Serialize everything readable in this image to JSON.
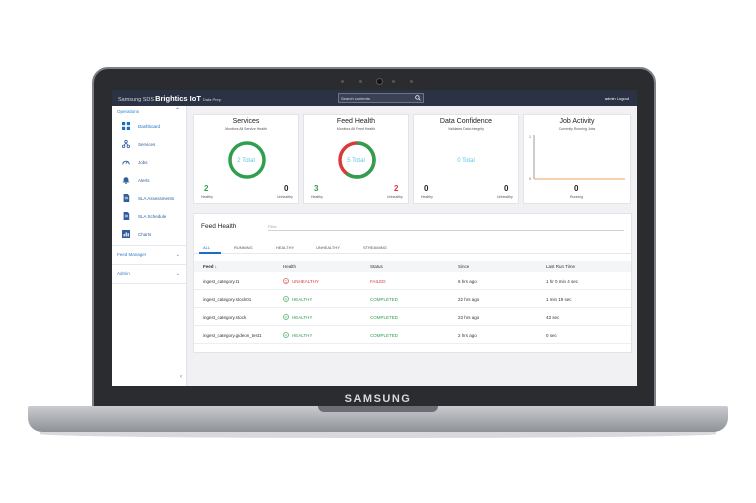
{
  "device": {
    "brand": "SAMSUNG"
  },
  "topbar": {
    "logo_prefix": "Samsung SDS",
    "logo_name": "Brightics IoT",
    "logo_suffix": "Data Prep",
    "search_placeholder": "Search contents",
    "user": "admin Logout"
  },
  "sidebar": {
    "operations_label": "Operations",
    "items": [
      {
        "label": "Dashboard",
        "icon": "grid-icon"
      },
      {
        "label": "Services",
        "icon": "network-icon"
      },
      {
        "label": "Jobs",
        "icon": "gauge-icon"
      },
      {
        "label": "Alerts",
        "icon": "bell-icon"
      },
      {
        "label": "SLA Assessments",
        "icon": "document-icon"
      },
      {
        "label": "SLA Schedule",
        "icon": "document-icon"
      },
      {
        "label": "Charts",
        "icon": "chart-icon"
      }
    ],
    "feed_manager_label": "Feed Manager",
    "admin_label": "Admin",
    "collapse_glyph": "‹"
  },
  "cards": [
    {
      "title": "Services",
      "subtitle": "Monitors All Service Health",
      "center": "2 Total",
      "left_num": "2",
      "left_label": "Healthy",
      "right_num": "0",
      "right_label": "Unhealthy"
    },
    {
      "title": "Feed Health",
      "subtitle": "Monitors All Feed Health",
      "center": "5 Total",
      "left_num": "3",
      "left_label": "Healthy",
      "right_num": "2",
      "right_label": "Unhealthy"
    },
    {
      "title": "Data Confidence",
      "subtitle": "Validates Data Integrity",
      "center": "0 Total",
      "left_num": "0",
      "left_label": "Healthy",
      "right_num": "0",
      "right_label": "Unhealthy"
    },
    {
      "title": "Job Activity",
      "subtitle": "Currently Running Jobs",
      "y_max": "1",
      "y_min": "0",
      "value": "0",
      "value_label": "Running"
    }
  ],
  "feed_health": {
    "title": "Feed Health",
    "filter_placeholder": "Filter",
    "tabs": [
      "ALL",
      "RUNNING",
      "HEALTHY",
      "UNHEALTHY",
      "STREAMING"
    ],
    "active_tab": "ALL",
    "columns": [
      "Feed",
      "Health",
      "Status",
      "Since",
      "Last Run Time"
    ],
    "sort_glyph": "↓",
    "rows": [
      {
        "feed": "ingest_category.t1",
        "health": "UNHEALTHY",
        "status": "FAILED",
        "since": "6 hrs ago",
        "last_run": "1 hr 0 min 4 sec"
      },
      {
        "feed": "ingest_category.stock01",
        "health": "HEALTHY",
        "status": "COMPLETED",
        "since": "22 hrs ago",
        "last_run": "1 min 19 sec"
      },
      {
        "feed": "ingest_category.stock",
        "health": "HEALTHY",
        "status": "COMPLETED",
        "since": "23 hrs ago",
        "last_run": "43 sec"
      },
      {
        "feed": "ingest_category.gideon_test1",
        "health": "HEALTHY",
        "status": "COMPLETED",
        "since": "2 hrs ago",
        "last_run": "0 sec"
      }
    ]
  },
  "colors": {
    "healthy": "#2e9e4f",
    "unhealthy": "#d93a3a",
    "accent": "#1b6fc2",
    "total_text": "#5bc6e8",
    "job_line": "#e8862b",
    "topbar": "#2b3243"
  }
}
